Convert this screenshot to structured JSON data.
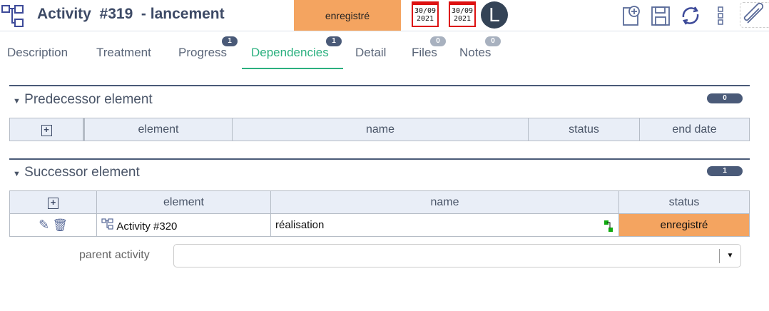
{
  "header": {
    "title": "Activity  #319  - lancement",
    "status": "enregistré",
    "status_color": "#f4a460",
    "start_date": [
      "30/09",
      "2021"
    ],
    "end_date": [
      "30/09",
      "2021"
    ],
    "avatar_letter": "L"
  },
  "tabs": [
    {
      "label": "Description"
    },
    {
      "label": "Treatment"
    },
    {
      "label": "Progress",
      "badge": "1"
    },
    {
      "label": "Dependencies",
      "badge": "1",
      "active": true
    },
    {
      "label": "Detail"
    },
    {
      "label": "Files",
      "badge": "0"
    },
    {
      "label": "Notes",
      "badge": "0"
    }
  ],
  "predecessor": {
    "title": "Predecessor element",
    "count": "0",
    "columns": [
      "element",
      "name",
      "status",
      "end date"
    ]
  },
  "successor": {
    "title": "Successor element",
    "count": "1",
    "columns": [
      "element",
      "name",
      "status"
    ],
    "rows": [
      {
        "element": "Activity #320",
        "name": "réalisation",
        "status": "enregistré"
      }
    ]
  },
  "parent_activity": {
    "label": "parent activity",
    "value": ""
  }
}
